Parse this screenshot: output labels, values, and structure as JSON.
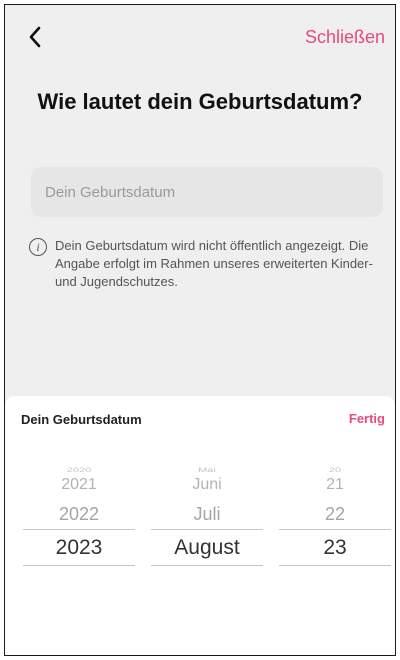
{
  "header": {
    "back_icon": "chevron-left-icon",
    "close_label": "Schließen",
    "accent_color": "#e84a7a"
  },
  "main": {
    "title": "Wie lautet dein Geburtsdatum?",
    "birthdate_placeholder": "Dein Geburtsdatum",
    "info_icon": "info-circle-icon",
    "info_text": "Dein Geburtsdatum wird nicht öffentlich angezeigt. Die Angabe erfolgt im Rahmen unseres erweiterten Kinder- und Jugendschutzes."
  },
  "sheet": {
    "title": "Dein Geburtsdatum",
    "done_label": "Fertig",
    "year": {
      "faint": "2020",
      "items": [
        "2021",
        "2022"
      ],
      "selected": "2023"
    },
    "month": {
      "faint": "Mai",
      "items": [
        "Juni",
        "Juli"
      ],
      "selected": "August"
    },
    "day": {
      "faint": "20",
      "items": [
        "21",
        "22"
      ],
      "selected": "23"
    }
  }
}
